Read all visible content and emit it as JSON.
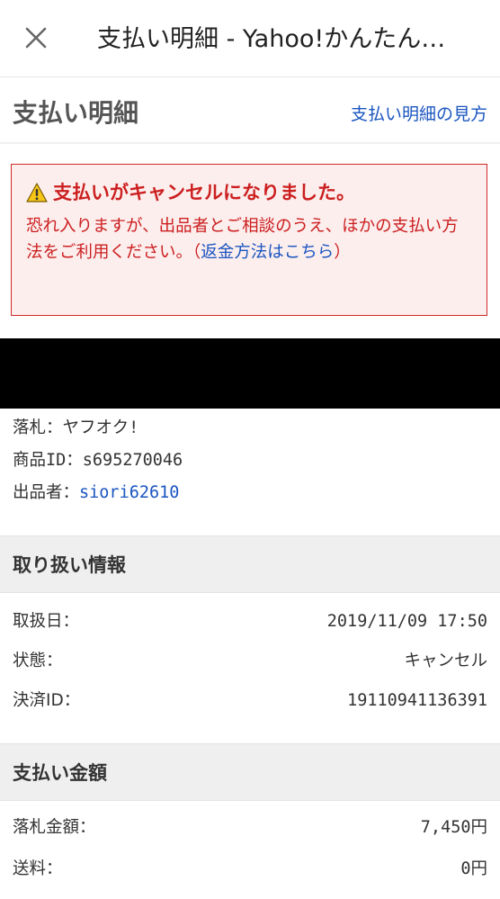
{
  "topbar": {
    "title": "支払い明細 - Yahoo!かんたん…"
  },
  "page": {
    "title": "支払い明細",
    "help_link": "支払い明細の見方"
  },
  "alert": {
    "title": "支払いがキャンセルになりました。",
    "body_prefix": "恐れ入りますが、出品者とご相談のうえ、ほかの支払い方法をご利用ください。（",
    "link": "返金方法はこちら",
    "body_suffix": "）",
    "color": "#cc1f1f"
  },
  "item": {
    "winner_label": "落札：",
    "winner_value": "ヤフオク!",
    "item_id_label": "商品ID：",
    "item_id_value": "s695270046",
    "seller_label": "出品者：",
    "seller_value": "siori62610"
  },
  "handling": {
    "header": "取り扱い情報",
    "rows": [
      {
        "label": "取扱日：",
        "value": "2019/11/09 17:50"
      },
      {
        "label": "状態：",
        "value": "キャンセル"
      },
      {
        "label": "決済ID：",
        "value": "19110941136391"
      }
    ]
  },
  "payment": {
    "header": "支払い金額",
    "rows": [
      {
        "label": "落札金額：",
        "value": "7,450円"
      },
      {
        "label": "送料：",
        "value": "0円"
      }
    ]
  },
  "colors": {
    "link": "#1a55c0",
    "section_bg": "#efefef"
  }
}
